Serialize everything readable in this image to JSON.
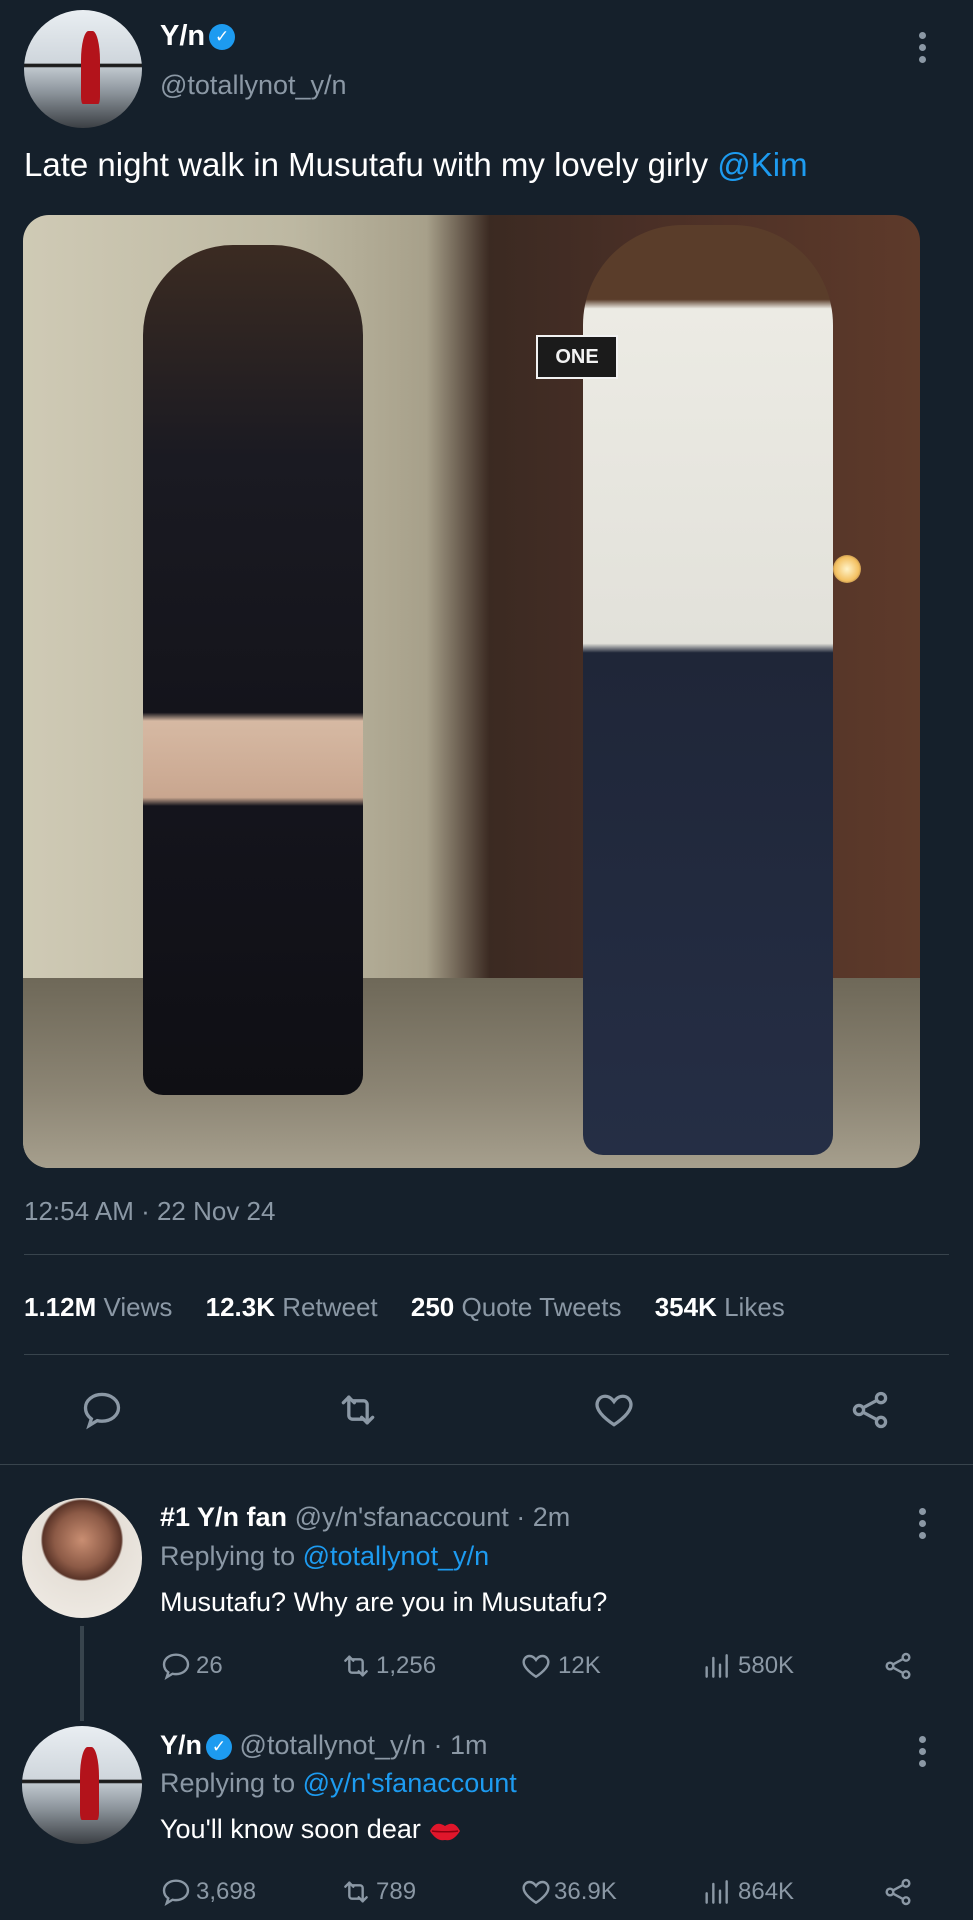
{
  "tweet": {
    "author_name": "Y/n",
    "handle": "@totallynot_y/n",
    "text_prefix": "Late night walk in Musutafu with my lovely girly ",
    "mention": "@Kim",
    "photo_sign_text": "ONE",
    "timestamp": "12:54 AM · 22 Nov 24",
    "stats": {
      "views_num": "1.12M",
      "views_label": "Views",
      "retweets_num": "12.3K",
      "retweets_label": "Retweet",
      "quotes_num": "250",
      "quotes_label": "Quote Tweets",
      "likes_num": "354K",
      "likes_label": "Likes"
    },
    "actions": [
      "reply-icon",
      "retweet-icon",
      "like-icon",
      "share-icon"
    ]
  },
  "replies": [
    {
      "author_name": "#1 Y/n fan",
      "handle_time": "@y/n'sfanaccount · 2m",
      "replying_label": "Replying to ",
      "replying_to": "@totallynot_y/n",
      "text": "Musutafu? Why are you in Musutafu?",
      "replies": "26",
      "retweets": "1,256",
      "likes": "12K",
      "views": "580K"
    },
    {
      "author_name": "Y/n",
      "handle_time": "@totallynot_y/n · 1m",
      "replying_label": "Replying to ",
      "replying_to": "@y/n'sfanaccount",
      "text": "You'll know soon dear",
      "replies": "3,698",
      "retweets": "789",
      "likes": "36.9K",
      "views": "864K"
    }
  ],
  "colors": {
    "background": "#15202b",
    "accent": "#1d9bf0",
    "muted": "#8b98a5",
    "divider": "#38444d"
  }
}
